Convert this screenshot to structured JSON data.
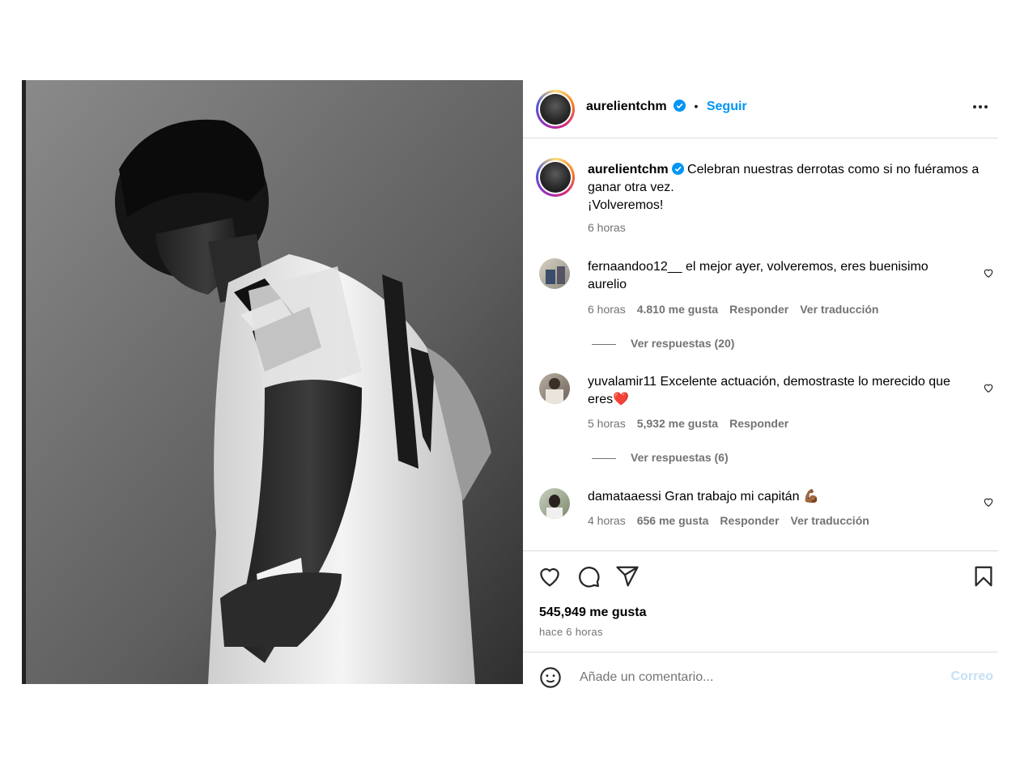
{
  "post": {
    "username": "aurelientchm",
    "follow_label": "Seguir",
    "separator": "•"
  },
  "caption": {
    "username": "aurelientchm",
    "text_line1": "Celebran nuestras derrotas como si no fuéramos a",
    "text_line2": "ganar otra vez.",
    "text_line3": "¡Volveremos!",
    "time": "6 horas"
  },
  "comments": [
    {
      "username": "fernaandoo12__",
      "text_line1": "el mejor ayer, volveremos, eres buenisimo",
      "text_line2": "aurelio",
      "time": "6 horas",
      "likes": "4.810 me gusta",
      "reply": "Responder",
      "translate": "Ver traducción",
      "replies": "Ver respuestas (20)"
    },
    {
      "username": "yuvalamir11",
      "text_line1": "Excelente actuación, demostraste lo merecido que",
      "text_line2": "eres",
      "emoji": "❤️",
      "time": "5 horas",
      "likes": "5,932 me gusta",
      "reply": "Responder",
      "replies": "Ver respuestas (6)"
    },
    {
      "username": "damataaessi",
      "text_line1": "Gran trabajo mi capitán",
      "emoji": "💪🏾",
      "time": "4 horas",
      "likes": "656 me gusta",
      "reply": "Responder",
      "translate": "Ver traducción"
    }
  ],
  "footer": {
    "likes": "545,949 me gusta",
    "time": "hace 6 horas",
    "comment_placeholder": "Añade un comentario...",
    "post_label": "Correo"
  },
  "colors": {
    "accent": "#0095f6",
    "muted": "#737373",
    "border": "#dbdbdb",
    "heart": "#e02020"
  },
  "icons": [
    "verified-badge-icon",
    "more-options-icon",
    "heart-icon",
    "comment-icon",
    "share-icon",
    "bookmark-icon",
    "emoji-icon"
  ]
}
